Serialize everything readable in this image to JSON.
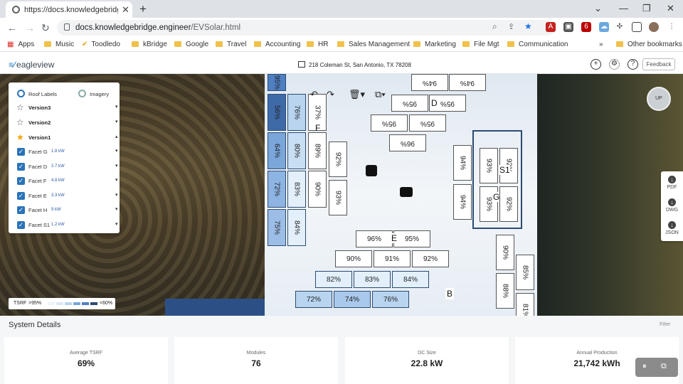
{
  "browser": {
    "tab_title": "https://docs.knowledgebridge.en",
    "url_host": "docs.knowledgebridge.engineer",
    "url_path": "/EVSolar.html",
    "bookmarks": [
      "Apps",
      "Music",
      "Toodledo",
      "kBridge",
      "Google",
      "Travel",
      "Accounting",
      "HR",
      "Sales Management",
      "Marketing",
      "File Mgt",
      "Communication"
    ],
    "more": "»",
    "other_bookmarks": "Other bookmarks"
  },
  "app": {
    "logo": "eagleview",
    "address": "218 Coleman St, San Antonio, TX 78208",
    "feedback_label": "Feedback"
  },
  "left_panel": {
    "roof_labels": "Roof Labels",
    "imagery": "Imagery",
    "versions": [
      "Version3",
      "Version2",
      "Version1"
    ],
    "facets": [
      {
        "name": "Facet G",
        "kw": "1.8 kW"
      },
      {
        "name": "Facet D",
        "kw": "2.7 kW"
      },
      {
        "name": "Facet F",
        "kw": "4.8 kW"
      },
      {
        "name": "Facet E",
        "kw": "3.3 kW"
      },
      {
        "name": "Facet H",
        "kw": "9 kW"
      },
      {
        "name": "Facet S1",
        "kw": "1.2 kW"
      }
    ]
  },
  "legend": {
    "label": "TSRF",
    "high": ">95%",
    "low": "<60%"
  },
  "map": {
    "facet_labels": [
      "F",
      "D",
      "E",
      "G",
      "S1",
      "B"
    ],
    "panels_col1": [
      "95%",
      "56%",
      "64%",
      "72%",
      "75%"
    ],
    "panels_col2": [
      "76%",
      "80%",
      "83%",
      "84%"
    ],
    "panels_col3": [
      "37%",
      "89%",
      "90%"
    ],
    "panels_col4": [
      "92%",
      "93%"
    ],
    "panels_D_row1": [
      "94%",
      "94%"
    ],
    "panels_D_row2": [
      "95%",
      "95%"
    ],
    "panels_D_row3": [
      "95%",
      "95%"
    ],
    "panels_D_row4": [
      "96%"
    ],
    "panels_G_left": [
      "94%",
      "94%"
    ],
    "panels_G_mid": [
      "93%",
      "93%"
    ],
    "panels_G_right": [
      "92%",
      "92%"
    ],
    "panels_E_row1": [
      "96%",
      "95%"
    ],
    "panels_E_row2": [
      "90%",
      "91%",
      "92%"
    ],
    "panels_E_row3": [
      "82%",
      "83%",
      "84%"
    ],
    "panels_E_row4": [
      "72%",
      "74%",
      "76%"
    ],
    "panels_B": [
      "90%",
      "88%",
      "85%",
      "81%"
    ],
    "up_label": "UP"
  },
  "right_tools": [
    "PDF",
    "DWG",
    "JSON"
  ],
  "system_details": {
    "title": "System Details",
    "filter": "Filter",
    "cards": [
      {
        "label": "Average TSRF",
        "value": "69%"
      },
      {
        "label": "Modules",
        "value": "76"
      },
      {
        "label": "DC Size",
        "value": "22.8 kW"
      },
      {
        "label": "Annual Production",
        "value": "21,742 kWh"
      }
    ]
  }
}
